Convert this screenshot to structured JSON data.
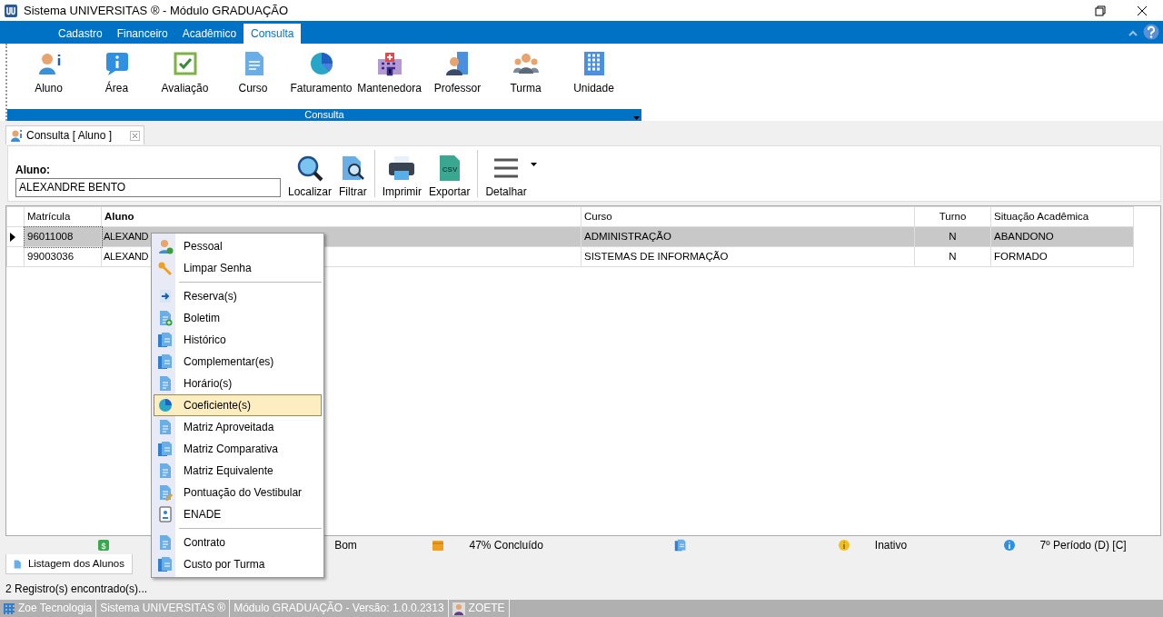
{
  "window": {
    "title": "Sistema UNIVERSITAS ® - Módulo GRADUAÇÃO"
  },
  "ribbon_tabs": [
    {
      "label": "Cadastro",
      "selected": false
    },
    {
      "label": "Financeiro",
      "selected": false
    },
    {
      "label": "Acadêmico",
      "selected": false
    },
    {
      "label": "Consulta",
      "selected": true
    }
  ],
  "ribbon_buttons": [
    "Aluno",
    "Área",
    "Avaliação",
    "Curso",
    "Faturamento",
    "Mantenedora",
    "Professor",
    "Turma",
    "Unidade"
  ],
  "ribbon_group": "Consulta",
  "document_tab": {
    "label": "Consulta [ Aluno ]"
  },
  "search": {
    "label": "Aluno:",
    "value": "ALEXANDRE BENTO"
  },
  "toolbar": [
    "Localizar",
    "Filtrar",
    "Imprimir",
    "Exportar",
    "Detalhar"
  ],
  "export_icon_text": "CSV",
  "table": {
    "columns": [
      "Matrícula",
      "Aluno",
      "Curso",
      "Turno",
      "Situação Acadêmica"
    ],
    "rows": [
      {
        "selected": true,
        "cells": [
          "96011008",
          "ALEXAND",
          "ADMINISTRAÇÃO",
          "N",
          "ABANDONO"
        ]
      },
      {
        "selected": false,
        "cells": [
          "99003036",
          "ALEXAND",
          "SISTEMAS DE INFORMAÇÃO",
          "N",
          "FORMADO"
        ]
      }
    ]
  },
  "context_menu": [
    [
      {
        "label": "Pessoal",
        "selected": false
      },
      {
        "label": "Limpar Senha",
        "selected": false
      }
    ],
    [
      {
        "label": "Reserva(s)",
        "selected": false
      },
      {
        "label": "Boletim",
        "selected": false
      },
      {
        "label": "Histórico",
        "selected": false
      },
      {
        "label": "Complementar(es)",
        "selected": false
      },
      {
        "label": "Horário(s)",
        "selected": false
      },
      {
        "label": "Coeficiente(s)",
        "selected": true
      },
      {
        "label": "Matriz Aproveitada",
        "selected": false
      },
      {
        "label": "Matriz Comparativa",
        "selected": false
      },
      {
        "label": "Matriz Equivalente",
        "selected": false
      },
      {
        "label": "Pontuação do Vestibular",
        "selected": false
      },
      {
        "label": "ENADE",
        "selected": false
      }
    ],
    [
      {
        "label": "Contrato",
        "selected": false
      },
      {
        "label": "Custo por Turma",
        "selected": false
      }
    ]
  ],
  "legend": [
    {
      "kind": "icon",
      "icon_text": "$"
    },
    {
      "kind": "text",
      "label": "Bom"
    },
    {
      "kind": "icon_text",
      "label": "47% Concluído"
    },
    {
      "kind": "icon"
    },
    {
      "kind": "icon_text",
      "label": "Inativo"
    },
    {
      "kind": "icon_text",
      "label": "7º Período (D) [C]"
    }
  ],
  "bottom_tab": {
    "label": "Listagem dos Alunos"
  },
  "record_count": "2 Registro(s) encontrado(s)...",
  "status_bar": [
    "Zoe Tecnologia",
    "Sistema UNIVERSITAS ®",
    "Módulo GRADUAÇÃO - Versão: 1.0.0.2313",
    "ZOETE"
  ]
}
